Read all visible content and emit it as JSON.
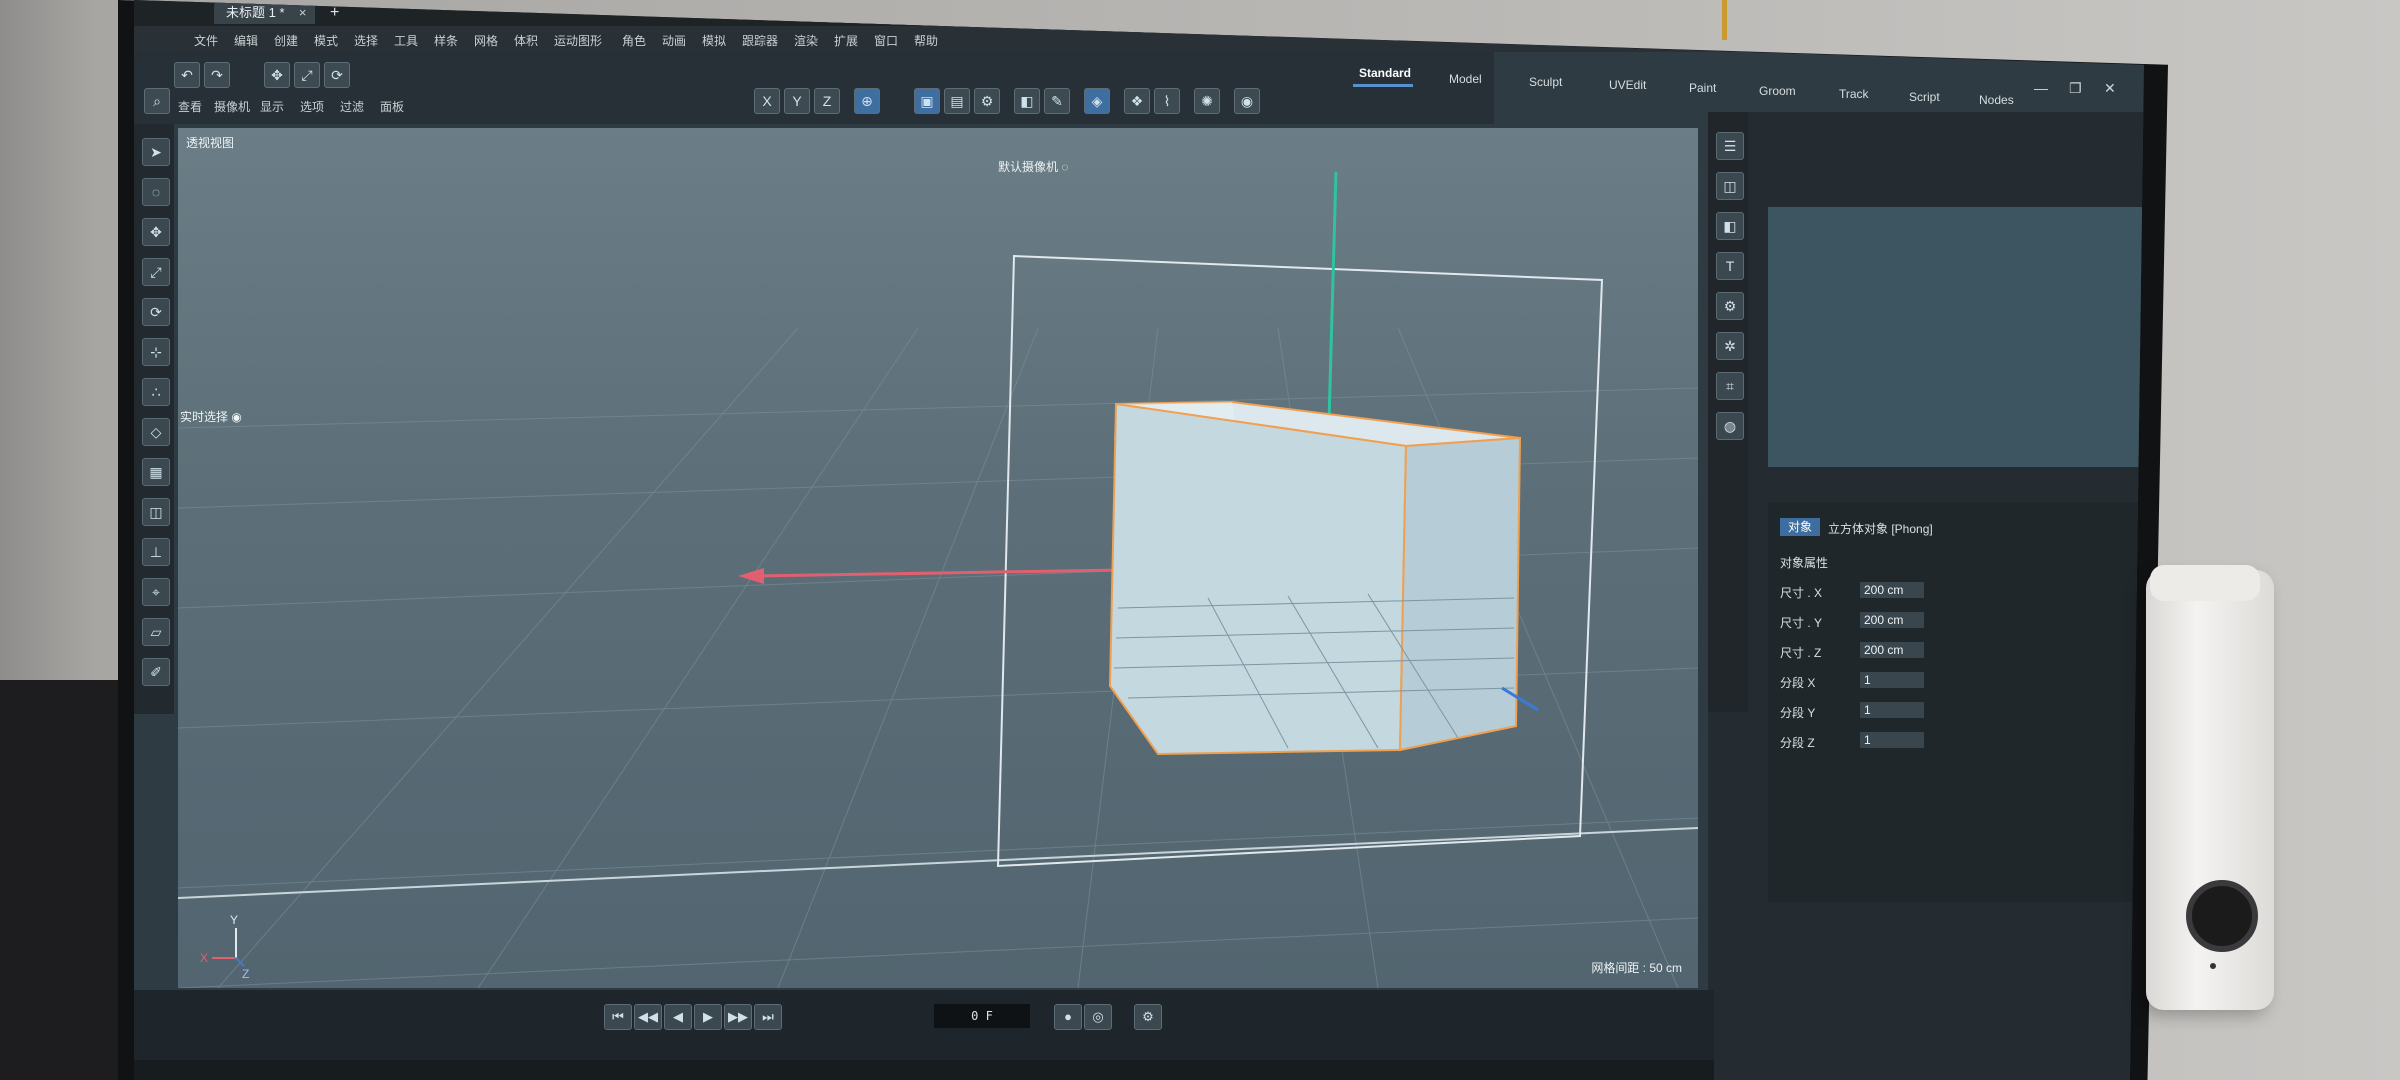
{
  "window": {
    "tab_title": "未标题 1 *",
    "tab_close": "×",
    "tab_add": "+"
  },
  "menus": [
    "文件",
    "编辑",
    "创建",
    "模式",
    "选择",
    "工具",
    "样条",
    "网格",
    "体积",
    "运动图形",
    "角色",
    "动画",
    "模拟",
    "跟踪器",
    "渲染",
    "扩展",
    "窗口",
    "帮助"
  ],
  "layouts": {
    "tabs": [
      "Standard",
      "Model",
      "Sculpt",
      "UVEdit",
      "Paint",
      "Groom",
      "Track",
      "Script",
      "Nodes"
    ],
    "active": "Standard"
  },
  "window_controls": {
    "minimize": "—",
    "restore": "❐",
    "close": "✕"
  },
  "viewport": {
    "view_name": "透视视图",
    "camera_label": "默认摄像机 ◌",
    "realtime_select": "实时选择 ◉",
    "grid_spacing": "网格间距 : 50 cm",
    "axis_labels": {
      "x": "X",
      "y": "Y",
      "z": "Z"
    }
  },
  "viewport_menu": [
    "查看",
    "摄像机",
    "显示",
    "选项",
    "过滤",
    "面板"
  ],
  "attributes": {
    "phong_tab": "立方体对象 [Phong]",
    "mode_btn": "对象",
    "section": "对象属性",
    "rows": [
      {
        "label": "尺寸 . X",
        "value": "200 cm"
      },
      {
        "label": "尺寸 . Y",
        "value": "200 cm"
      },
      {
        "label": "尺寸 . Z",
        "value": "200 cm"
      },
      {
        "label": "分段 X",
        "value": "1"
      },
      {
        "label": "分段 Y",
        "value": "1"
      },
      {
        "label": "分段 Z",
        "value": "1"
      }
    ]
  },
  "timeline": {
    "display": "0 F",
    "buttons": [
      "⏮",
      "◀◀",
      "◀",
      "▶",
      "▶▶",
      "⏭",
      "●",
      "◎",
      "⚙"
    ]
  },
  "colors": {
    "accent": "#5a8fd0",
    "x_axis": "#e06070",
    "y_axis": "#2ec4a0",
    "z_axis": "#3a7ad8",
    "cube_edge": "#f0a050"
  }
}
